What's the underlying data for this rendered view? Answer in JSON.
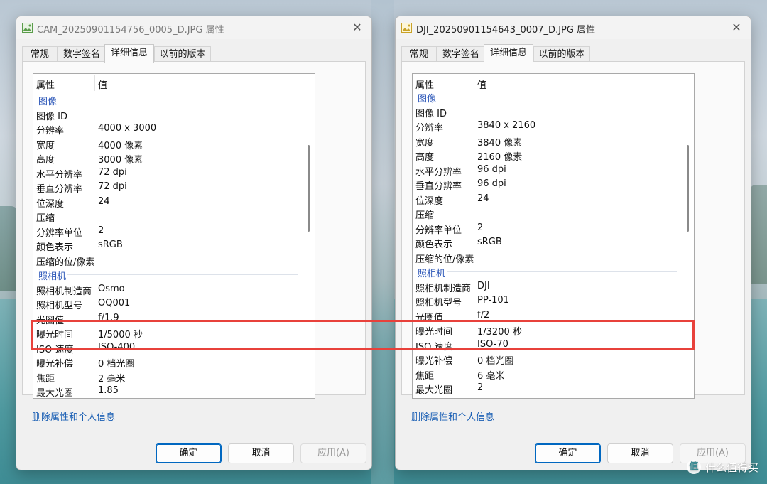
{
  "colors": {
    "link": "#1a5fb4",
    "group_header": "#2e58b9",
    "highlight_border": "#e8413b",
    "primary_button_border": "#0067c0"
  },
  "headers": {
    "property": "属性",
    "value": "值"
  },
  "tabs": [
    "常规",
    "数字签名",
    "详细信息",
    "以前的版本"
  ],
  "active_tab_index": 2,
  "buttons": {
    "ok": "确定",
    "cancel": "取消",
    "apply": "应用(A)"
  },
  "remove_link": "删除属性和个人信息",
  "left_window": {
    "title": "CAM_20250901154756_0005_D.JPG 属性",
    "scroll_position": 0.3,
    "rows": [
      {
        "type": "group",
        "label": "图像"
      },
      {
        "k": "图像 ID",
        "v": ""
      },
      {
        "k": "分辨率",
        "v": "4000 x 3000"
      },
      {
        "k": "宽度",
        "v": "4000 像素"
      },
      {
        "k": "高度",
        "v": "3000 像素"
      },
      {
        "k": "水平分辨率",
        "v": "72 dpi"
      },
      {
        "k": "垂直分辨率",
        "v": "72 dpi"
      },
      {
        "k": "位深度",
        "v": "24"
      },
      {
        "k": "压缩",
        "v": ""
      },
      {
        "k": "分辨率单位",
        "v": "2"
      },
      {
        "k": "颜色表示",
        "v": "sRGB"
      },
      {
        "k": "压缩的位/像素",
        "v": ""
      },
      {
        "type": "group",
        "label": "照相机"
      },
      {
        "k": "照相机制造商",
        "v": "Osmo"
      },
      {
        "k": "照相机型号",
        "v": "OQ001"
      },
      {
        "k": "光圈值",
        "v": "f/1.9"
      },
      {
        "k": "曝光时间",
        "v": "1/5000 秒"
      },
      {
        "k": "ISO 速度",
        "v": "ISO-400"
      },
      {
        "k": "曝光补偿",
        "v": "0 档光圈"
      },
      {
        "k": "焦距",
        "v": "2 毫米"
      },
      {
        "k": "最大光圈",
        "v": "1.85"
      }
    ]
  },
  "right_window": {
    "title": "DJI_20250901154643_0007_D.JPG 属性",
    "scroll_position": 0.3,
    "rows": [
      {
        "type": "group",
        "label": "图像"
      },
      {
        "k": "图像 ID",
        "v": ""
      },
      {
        "k": "分辨率",
        "v": "3840 x 2160"
      },
      {
        "k": "宽度",
        "v": "3840 像素"
      },
      {
        "k": "高度",
        "v": "2160 像素"
      },
      {
        "k": "水平分辨率",
        "v": "96 dpi"
      },
      {
        "k": "垂直分辨率",
        "v": "96 dpi"
      },
      {
        "k": "位深度",
        "v": "24"
      },
      {
        "k": "压缩",
        "v": ""
      },
      {
        "k": "分辨率单位",
        "v": "2"
      },
      {
        "k": "颜色表示",
        "v": "sRGB"
      },
      {
        "k": "压缩的位/像素",
        "v": ""
      },
      {
        "type": "group",
        "label": "照相机"
      },
      {
        "k": "照相机制造商",
        "v": "DJI"
      },
      {
        "k": "照相机型号",
        "v": "PP-101"
      },
      {
        "k": "光圈值",
        "v": "f/2"
      },
      {
        "k": "曝光时间",
        "v": "1/3200 秒"
      },
      {
        "k": "ISO 速度",
        "v": "ISO-70"
      },
      {
        "k": "曝光补偿",
        "v": "0 档光圈"
      },
      {
        "k": "焦距",
        "v": "6 毫米"
      },
      {
        "k": "最大光圈",
        "v": "2"
      }
    ]
  },
  "watermark": {
    "text": "什么值得买",
    "logo": "值"
  }
}
